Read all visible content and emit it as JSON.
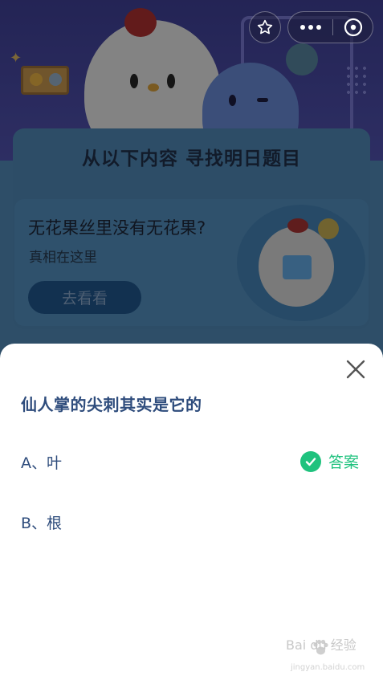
{
  "topbar": {
    "star_icon": "star-outline-icon",
    "more_icon": "more-dots-icon",
    "close_icon": "close-circle-icon"
  },
  "background": {
    "section_title": "从以下内容 寻找明日题目",
    "promo": {
      "title": "无花果丝里没有无花果?",
      "subtitle": "真相在这里",
      "button_label": "去看看"
    }
  },
  "quiz": {
    "question": "仙人掌的尖刺其实是它的",
    "options": [
      {
        "label": "A、叶",
        "is_answer": true
      },
      {
        "label": "B、根",
        "is_answer": false
      }
    ],
    "answer_label": "答案",
    "close_icon": "close-x-icon"
  },
  "watermark": {
    "text": "Bai du 经验",
    "sub": "jingyan.baidu.com"
  },
  "colors": {
    "accent_green": "#1fc27e",
    "question_text": "#2e4c7c",
    "promo_button": "#1d4f82"
  }
}
